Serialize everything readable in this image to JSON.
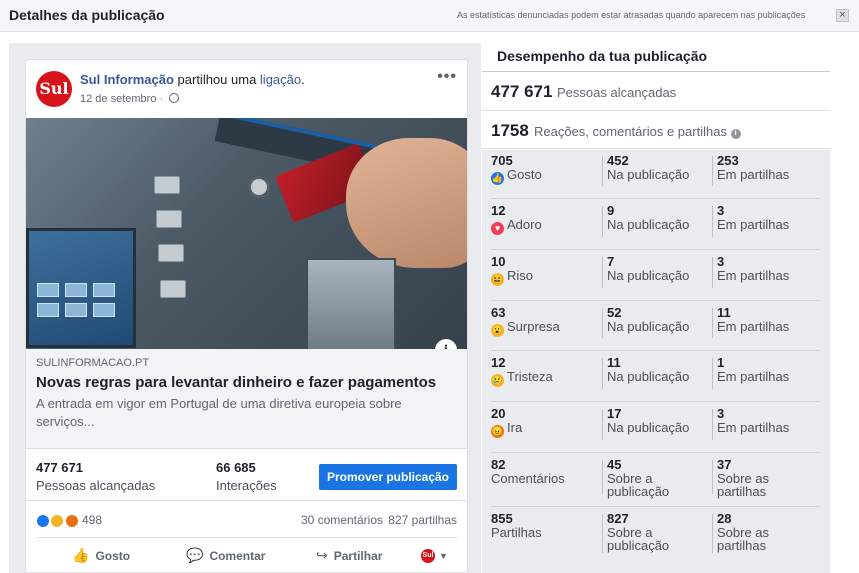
{
  "dialog": {
    "title": "Detalhes da publicação",
    "note": "As estatísticas denunciadas podem estar atrasadas quando aparecem nas publicações",
    "close_label": "×"
  },
  "post": {
    "page_name": "Sul Informação",
    "action_text": " partilhou uma ",
    "link_word": "ligação",
    "link_suffix": ".",
    "date": "12 de setembro",
    "date_sep": " · ",
    "menu_label": "•••",
    "avatar_text": "Sul",
    "link": {
      "domain": "SULINFORMACAO.PT",
      "title": "Novas regras para levantar dinheiro e fazer pagamentos",
      "description": "A entrada em vigor em Portugal de uma diretiva europeia sobre serviços...",
      "info_label": "i"
    },
    "insights": {
      "reach_value": "477 671",
      "reach_label": "Pessoas alcançadas",
      "interactions_value": "66 685",
      "interactions_label": "Interações",
      "promote_label": "Promover publicação"
    },
    "reactions": {
      "count": "498",
      "comments": "30 comentários",
      "shares": "827 partilhas"
    },
    "actions": {
      "like": "Gosto",
      "comment": "Comentar",
      "share": "Partilhar",
      "like_icon": "thumb-icon",
      "comment_icon": "speech-bubble-icon",
      "share_icon": "share-arrow-icon"
    }
  },
  "performance": {
    "title": "Desempenho da tua publicação",
    "reach_value": "477 671",
    "reach_label": "Pessoas alcançadas",
    "interactions_value": "1758",
    "interactions_label": "Reações, comentários e partilhas",
    "rows": [
      {
        "total": "705",
        "label": "Gosto",
        "icon": "like",
        "color": "#1877f2",
        "on_post": "452",
        "on_post_label": "Na publicação",
        "on_shares": "253",
        "on_shares_label": "Em partilhas"
      },
      {
        "total": "12",
        "label": "Adoro",
        "icon": "love",
        "color": "#f33e58",
        "on_post": "9",
        "on_post_label": "Na publicação",
        "on_shares": "3",
        "on_shares_label": "Em partilhas"
      },
      {
        "total": "10",
        "label": "Riso",
        "icon": "haha",
        "color": "#f7b125",
        "on_post": "7",
        "on_post_label": "Na publicação",
        "on_shares": "3",
        "on_shares_label": "Em partilhas"
      },
      {
        "total": "63",
        "label": "Surpresa",
        "icon": "wow",
        "color": "#f7b125",
        "on_post": "52",
        "on_post_label": "Na publicação",
        "on_shares": "11",
        "on_shares_label": "Em partilhas"
      },
      {
        "total": "12",
        "label": "Tristeza",
        "icon": "sad",
        "color": "#f7b125",
        "on_post": "11",
        "on_post_label": "Na publicação",
        "on_shares": "1",
        "on_shares_label": "Em partilhas"
      },
      {
        "total": "20",
        "label": "Ira",
        "icon": "angry",
        "color": "#e9710f",
        "on_post": "17",
        "on_post_label": "Na publicação",
        "on_shares": "3",
        "on_shares_label": "Em partilhas"
      },
      {
        "total": "82",
        "label": "Comentários",
        "icon": "",
        "color": "",
        "on_post": "45",
        "on_post_label": "Sobre a publicação",
        "on_shares": "37",
        "on_shares_label": "Sobre as partilhas"
      },
      {
        "total": "855",
        "label": "Partilhas",
        "icon": "",
        "color": "",
        "on_post": "827",
        "on_post_label": "Sobre a publicação",
        "on_shares": "28",
        "on_shares_label": "Sobre as partilhas"
      }
    ]
  },
  "colors": {
    "accent": "#1b74e4",
    "link": "#385898",
    "brand_red": "#d6131b"
  }
}
